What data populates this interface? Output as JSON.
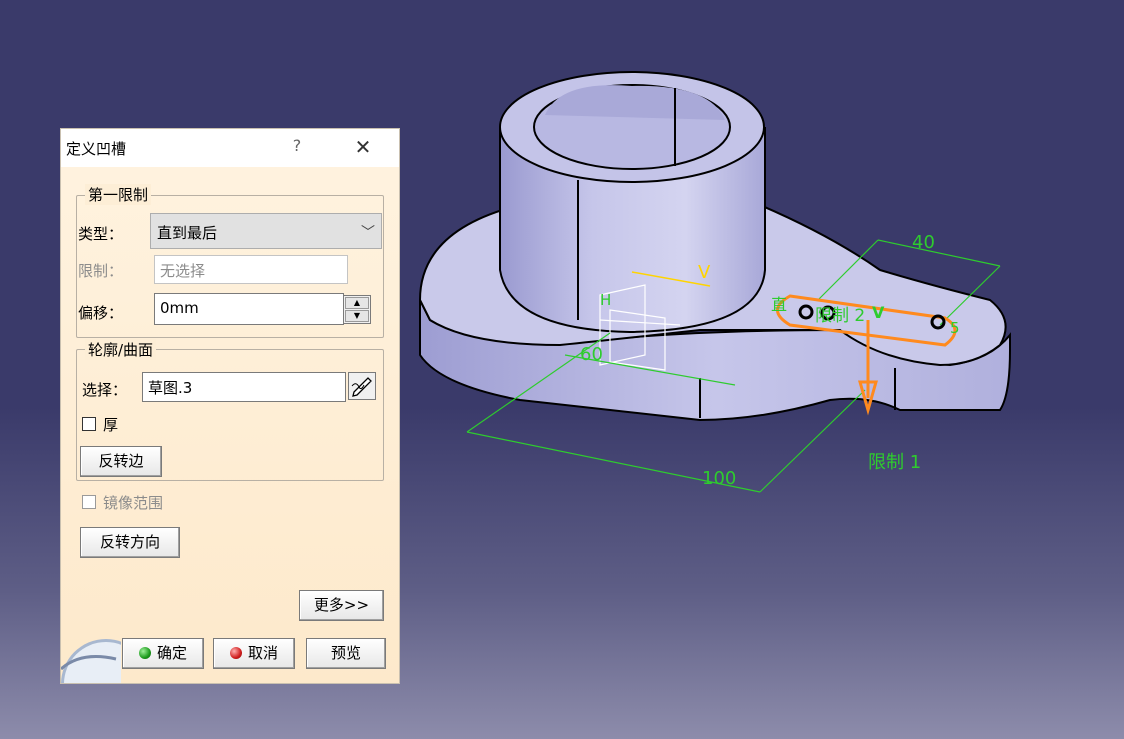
{
  "dialog": {
    "title": "定义凹槽",
    "help": "?",
    "close": "✕",
    "first_limit": {
      "legend": "第一限制",
      "type_label": "类型：",
      "type_value": "直到最后",
      "limit_label": "限制：",
      "limit_value": "无选择",
      "offset_label": "偏移：",
      "offset_value": "0mm"
    },
    "profile": {
      "legend": "轮廓/曲面",
      "select_label": "选择：",
      "select_value": "草图.3",
      "thick_label": "厚",
      "reverse_side_button": "反转边"
    },
    "mirror_label": "镜像范围",
    "reverse_direction_button": "反转方向",
    "more_button": "更多>>",
    "ok_button": "确定",
    "cancel_button": "取消",
    "preview_button": "预览"
  },
  "viewport": {
    "dim_40": "40",
    "dim_60": "60",
    "dim_100": "100",
    "label_limit1": "限制 1",
    "label_limit2": "限制 2",
    "label_v": "V",
    "label_h": "H",
    "label_zhi": "直",
    "label_5": "5"
  },
  "colors": {
    "background_top": "#3a3a6a",
    "dialog_bg": "#fdeed6",
    "dimension": "#2ecc2e",
    "highlight": "#ff8a1e"
  }
}
